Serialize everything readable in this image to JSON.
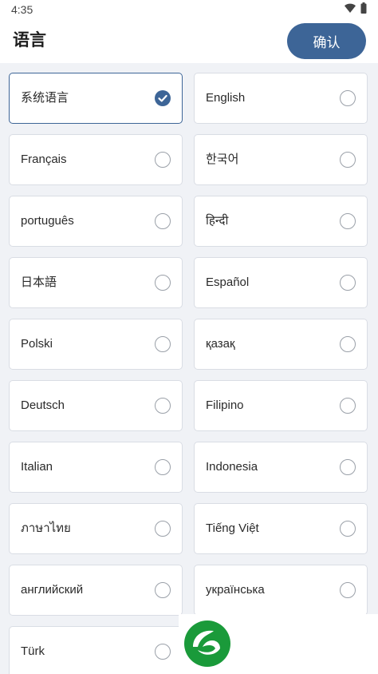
{
  "status_bar": {
    "time": "4:35",
    "icons": [
      "wifi-icon",
      "battery-icon"
    ]
  },
  "header": {
    "title": "语言",
    "confirm_label": "确认"
  },
  "colors": {
    "accent": "#3d6597",
    "background": "#f0f2f6",
    "card": "#ffffff",
    "logo_green": "#1a9a3a"
  },
  "languages": [
    {
      "label": "系统语言",
      "selected": true
    },
    {
      "label": "English",
      "selected": false
    },
    {
      "label": "Français",
      "selected": false
    },
    {
      "label": "한국어",
      "selected": false
    },
    {
      "label": "português",
      "selected": false
    },
    {
      "label": "हिन्दी",
      "selected": false
    },
    {
      "label": "日本語",
      "selected": false
    },
    {
      "label": "Español",
      "selected": false
    },
    {
      "label": "Polski",
      "selected": false
    },
    {
      "label": "қазақ",
      "selected": false
    },
    {
      "label": "Deutsch",
      "selected": false
    },
    {
      "label": "Filipino",
      "selected": false
    },
    {
      "label": "Italian",
      "selected": false
    },
    {
      "label": "Indonesia",
      "selected": false
    },
    {
      "label": "ภาษาไทย",
      "selected": false
    },
    {
      "label": "Tiếng Việt",
      "selected": false
    },
    {
      "label": "английский",
      "selected": false
    },
    {
      "label": "українська",
      "selected": false
    },
    {
      "label": "Türk",
      "selected": false
    }
  ]
}
